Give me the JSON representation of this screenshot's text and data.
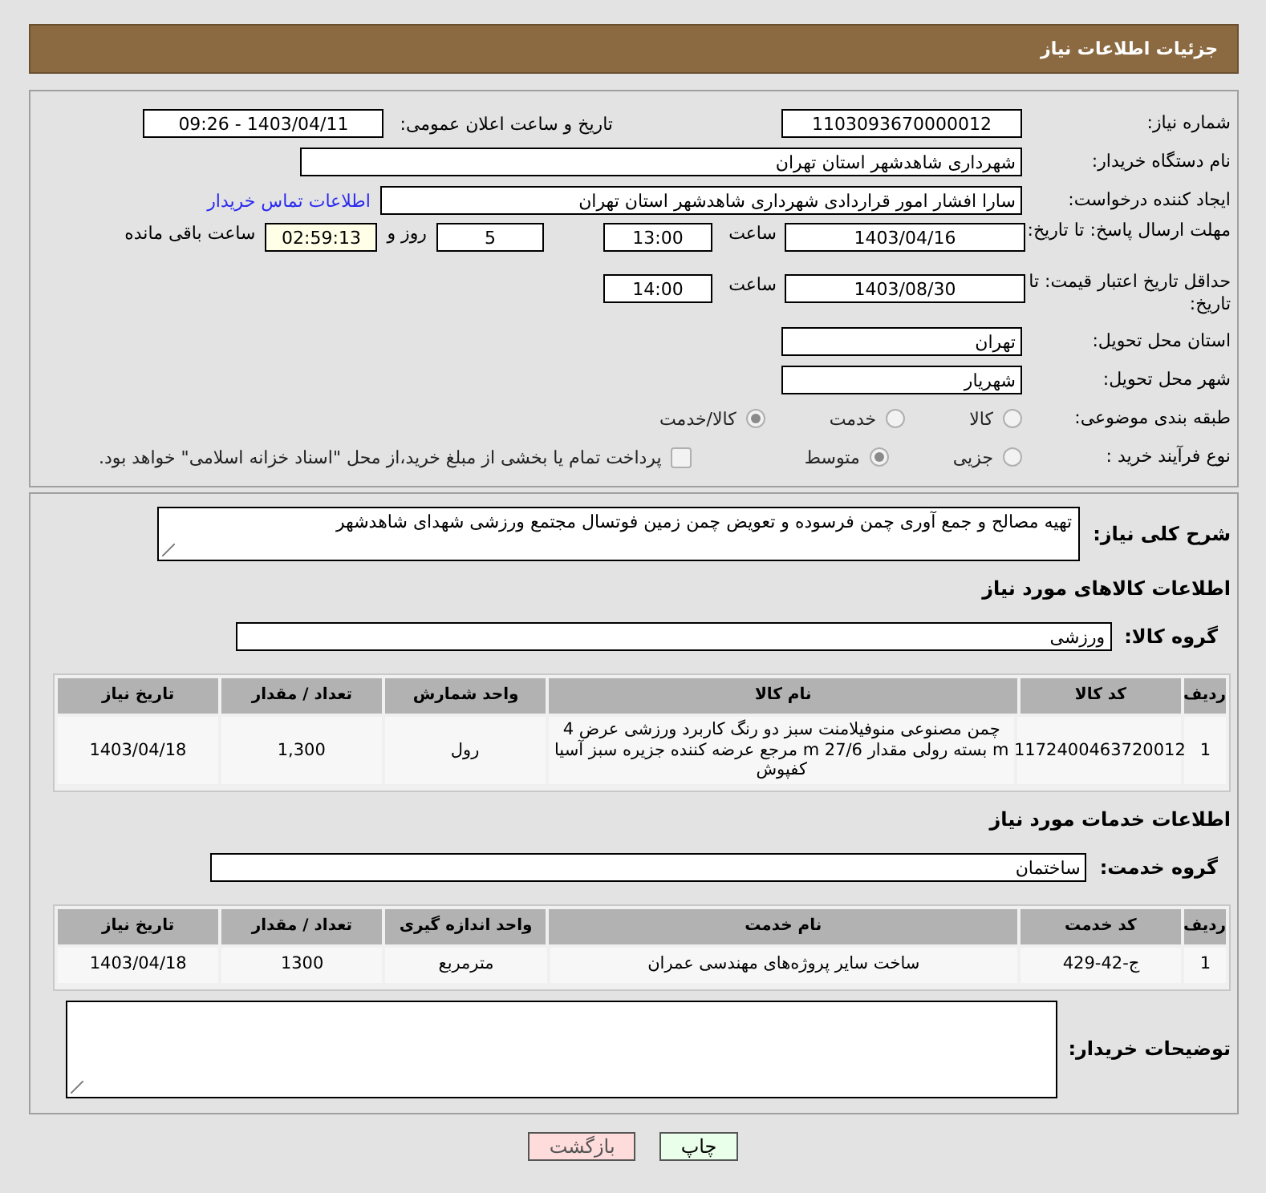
{
  "header": {
    "title": "جزئیات اطلاعات نیاز"
  },
  "need_number": {
    "label": "شماره نیاز:",
    "value": "1103093670000012"
  },
  "announce": {
    "label": "تاریخ و ساعت اعلان عمومی:",
    "value": "1403/04/11 - 09:26"
  },
  "buyer": {
    "label": "نام دستگاه خریدار:",
    "value": "شهرداری شاهدشهر استان تهران"
  },
  "requester": {
    "label": "ایجاد کننده درخواست:",
    "value": "سارا افشار امور قراردادی شهرداری شاهدشهر استان تهران",
    "link": "اطلاعات تماس خریدار"
  },
  "reply_deadline": {
    "label": "مهلت ارسال پاسخ: تا تاریخ:",
    "date": "1403/04/16",
    "time_label": "ساعت",
    "time": "13:00",
    "days": "5",
    "days_label": "روز و",
    "remaining": "02:59:13",
    "remaining_label": "ساعت باقی مانده"
  },
  "price_validity": {
    "label": "حداقل تاریخ اعتبار قیمت: تا تاریخ:",
    "date": "1403/08/30",
    "time_label": "ساعت",
    "time": "14:00"
  },
  "province": {
    "label": "استان محل تحویل:",
    "value": "تهران"
  },
  "city": {
    "label": "شهر محل تحویل:",
    "value": "شهریار"
  },
  "category": {
    "label": "طبقه بندی موضوعی:",
    "options": [
      {
        "label": "کالا",
        "selected": false
      },
      {
        "label": "خدمت",
        "selected": false
      },
      {
        "label": "کالا/خدمت",
        "selected": true
      }
    ]
  },
  "purchase_process": {
    "label": "نوع فرآیند خرید :",
    "options": [
      {
        "label": "جزیی",
        "selected": false
      },
      {
        "label": "متوسط",
        "selected": true
      }
    ],
    "treasury": {
      "checked": false,
      "text": "پرداخت تمام یا بخشی از مبلغ خرید،از محل \"اسناد خزانه اسلامی\" خواهد بود."
    }
  },
  "description": {
    "label": "شرح کلی نیاز:",
    "value": "تهیه مصالح و جمع آوری چمن فرسوده  و تعویض چمن زمین فوتسال مجتمع ورزشی شهدای شاهدشهر"
  },
  "goods": {
    "title": "اطلاعات کالاهای مورد نیاز",
    "group_label": "گروه کالا:",
    "group": "ورزشی",
    "columns": [
      "ردیف",
      "کد کالا",
      "نام کالا",
      "واحد شمارش",
      "تعداد / مقدار",
      "تاریخ نیاز"
    ],
    "rows": [
      [
        "1",
        "1172400463720012",
        "چمن مصنوعی منوفیلامنت سبز دو رنگ کاربرد ورزشی عرض 4 m بسته رولی مقدار 27/6 m مرجع عرضه کننده جزیره سبز آسیا کفپوش",
        "رول",
        "1,300",
        "1403/04/18"
      ]
    ]
  },
  "services": {
    "title": "اطلاعات خدمات مورد نیاز",
    "group_label": "گروه خدمت:",
    "group": "ساختمان",
    "columns": [
      "ردیف",
      "کد خدمت",
      "نام خدمت",
      "واحد اندازه گیری",
      "تعداد / مقدار",
      "تاریخ نیاز"
    ],
    "rows": [
      [
        "1",
        "ج-42-429",
        "ساخت سایر پروژه‌های مهندسی عمران",
        "مترمربع",
        "1300",
        "1403/04/18"
      ]
    ]
  },
  "buyer_notes": {
    "label": "توضیحات خریدار:"
  },
  "buttons": [
    {
      "label": "چاپ",
      "kind": "print"
    },
    {
      "label": "بازگشت",
      "kind": "back"
    }
  ]
}
